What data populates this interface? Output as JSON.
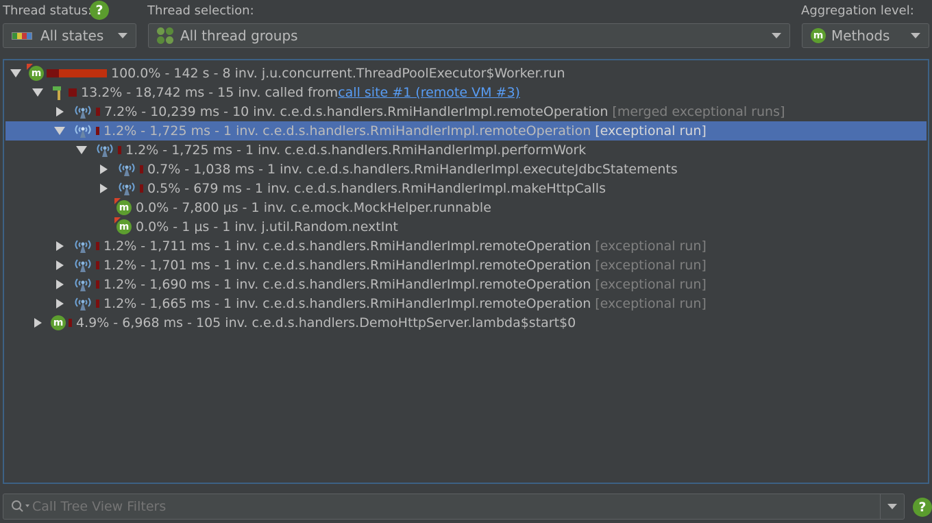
{
  "header": {
    "thread_status_label": "Thread status:",
    "thread_status_value": "All states",
    "thread_selection_label": "Thread selection:",
    "thread_selection_value": "All thread groups",
    "aggregation_label": "Aggregation level:",
    "aggregation_value": "Methods",
    "help_glyph": "?"
  },
  "tree": {
    "rows": [
      {
        "text": "100.0% - 142 s - 8 inv. j.u.concurrent.ThreadPoolExecutor$Worker.run",
        "suffix": "",
        "link": "",
        "icon": "method-icon",
        "toggle": "expanded",
        "bar_fraction": 1.0,
        "selected": false
      },
      {
        "text": "13.2% - 18,742 ms - 15 inv. called from ",
        "suffix": "",
        "link": "call site #1 (remote VM #3)",
        "icon": "call-site-icon",
        "toggle": "expanded",
        "bar_fraction": 0.132,
        "selected": false
      },
      {
        "text": "7.2% - 10,239 ms - 10 inv. c.e.d.s.handlers.RmiHandlerImpl.remoteOperation",
        "suffix": "[merged exceptional runs]",
        "link": "",
        "icon": "remote-call-icon",
        "toggle": "collapsed",
        "bar_fraction": 0.072,
        "selected": false
      },
      {
        "text": "1.2% - 1,725 ms - 1 inv. c.e.d.s.handlers.RmiHandlerImpl.remoteOperation",
        "suffix": "[exceptional run]",
        "link": "",
        "icon": "remote-call-icon",
        "toggle": "expanded",
        "bar_fraction": 0.012,
        "selected": true
      },
      {
        "text": "1.2% - 1,725 ms - 1 inv. c.e.d.s.handlers.RmiHandlerImpl.performWork",
        "suffix": "",
        "link": "",
        "icon": "remote-call-icon",
        "toggle": "expanded",
        "bar_fraction": 0.012,
        "selected": false
      },
      {
        "text": "0.7% - 1,038 ms - 1 inv. c.e.d.s.handlers.RmiHandlerImpl.executeJdbcStatements",
        "suffix": "",
        "link": "",
        "icon": "remote-call-icon",
        "toggle": "collapsed",
        "bar_fraction": 0.007,
        "selected": false
      },
      {
        "text": "0.5% - 679 ms - 1 inv. c.e.d.s.handlers.RmiHandlerImpl.makeHttpCalls",
        "suffix": "",
        "link": "",
        "icon": "remote-call-icon",
        "toggle": "collapsed",
        "bar_fraction": 0.005,
        "selected": false
      },
      {
        "text": "0.0% - 7,800 µs - 1 inv. c.e.mock.MockHelper.runnable",
        "suffix": "",
        "link": "",
        "icon": "method-icon",
        "toggle": "none",
        "bar_fraction": 0.0,
        "selected": false
      },
      {
        "text": "0.0% - 1 µs - 1 inv. j.util.Random.nextInt",
        "suffix": "",
        "link": "",
        "icon": "method-icon",
        "toggle": "none",
        "bar_fraction": 0.0,
        "selected": false
      },
      {
        "text": "1.2% - 1,711 ms - 1 inv. c.e.d.s.handlers.RmiHandlerImpl.remoteOperation",
        "suffix": "[exceptional run]",
        "link": "",
        "icon": "remote-call-icon",
        "toggle": "collapsed",
        "bar_fraction": 0.012,
        "selected": false
      },
      {
        "text": "1.2% - 1,701 ms - 1 inv. c.e.d.s.handlers.RmiHandlerImpl.remoteOperation",
        "suffix": "[exceptional run]",
        "link": "",
        "icon": "remote-call-icon",
        "toggle": "collapsed",
        "bar_fraction": 0.012,
        "selected": false
      },
      {
        "text": "1.2% - 1,690 ms - 1 inv. c.e.d.s.handlers.RmiHandlerImpl.remoteOperation",
        "suffix": "[exceptional run]",
        "link": "",
        "icon": "remote-call-icon",
        "toggle": "collapsed",
        "bar_fraction": 0.012,
        "selected": false
      },
      {
        "text": "1.2% - 1,665 ms - 1 inv. c.e.d.s.handlers.RmiHandlerImpl.remoteOperation",
        "suffix": "[exceptional run]",
        "link": "",
        "icon": "remote-call-icon",
        "toggle": "collapsed",
        "bar_fraction": 0.012,
        "selected": false
      },
      {
        "text": "4.9% - 6,968 ms - 105 inv. c.e.d.s.handlers.DemoHttpServer.lambda$start$0",
        "suffix": "",
        "link": "",
        "icon": "method-icon",
        "toggle": "collapsed",
        "bar_fraction": 0.049,
        "selected": false
      }
    ]
  },
  "filter": {
    "placeholder": "Call Tree View Filters"
  },
  "colors": {
    "background": "#3c3f41",
    "selection": "#4b6eaf",
    "link": "#589df6",
    "bar_fill": "#c0300e",
    "bar_dark": "#7a0f0f",
    "method_badge": "#5d9e2f"
  }
}
